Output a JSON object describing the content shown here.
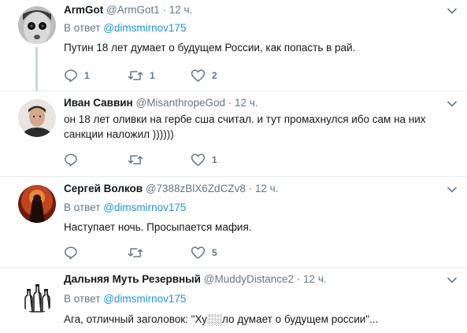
{
  "colors": {
    "link": "#1b95e0",
    "muted": "#657786",
    "text": "#14171a",
    "divider": "#e6ecf0",
    "thread": "#ccd6dd"
  },
  "icons": {
    "reply": "reply-icon",
    "retweet": "retweet-icon",
    "like": "heart-icon",
    "menu": "chevron-down-icon"
  },
  "tweets": [
    {
      "name": "ArmGot",
      "handle": "@ArmGot1",
      "dot": "·",
      "time": "12 ч.",
      "reply_prefix": "В ответ",
      "reply_to": "@dimsmirnov175",
      "text": "Путин 18 лет  думает о будущем России, как попасть в рай.",
      "replies": "1",
      "retweets": "1",
      "likes": "2"
    },
    {
      "name": "Иван Саввин",
      "handle": "@MisanthropeGod",
      "dot": "·",
      "time": "12 ч.",
      "text": "он 18 лет оливки на гербе сша считал. и тут промахнулся ибо сам на них санкции наложил ))))))",
      "replies": "",
      "retweets": "",
      "likes": "1"
    },
    {
      "name": "Сергей Волков",
      "handle": "@7388zBlX6ZdCZv8",
      "dot": "·",
      "time": "12 ч.",
      "reply_prefix": "В ответ",
      "reply_to": "@dimsmirnov175",
      "text": "Наступает ночь. Просыпается мафия.",
      "replies": "",
      "retweets": "",
      "likes": "5"
    },
    {
      "name": "Дальняя Муть Резервный",
      "handle": "@MuddyDistance2",
      "dot": "·",
      "time": "12 ч.",
      "reply_prefix": "В ответ",
      "reply_to": "@dimsmirnov175",
      "text": "Ага, отличный заголовок: \"Ху░░ло думает о будущем россии\"..."
    }
  ]
}
